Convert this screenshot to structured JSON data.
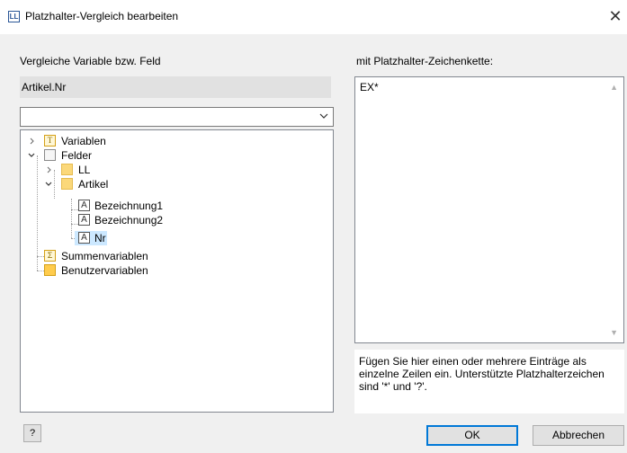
{
  "window": {
    "app_icon_text": "LL",
    "title": "Platzhalter-Vergleich bearbeiten",
    "close_glyph": "✕"
  },
  "left": {
    "label": "Vergleiche Variable bzw. Feld",
    "selected_value": "Artikel.Nr",
    "combo_value": "",
    "tree": {
      "variablen": "Variablen",
      "felder": "Felder",
      "ll": "LL",
      "artikel": "Artikel",
      "bezeichnung1": "Bezeichnung1",
      "bezeichnung2": "Bezeichnung2",
      "nr": "Nr",
      "summenvariablen": "Summenvariablen",
      "benutzervariablen": "Benutzervariablen"
    }
  },
  "right": {
    "label": "mit Platzhalter-Zeichenkette:",
    "pattern_value": "EX*",
    "hint": "Fügen Sie hier einen oder mehrere Einträge als einzelne Zeilen ein. Unterstützte Platzhalterzeichen sind '*' und '?'."
  },
  "buttons": {
    "help": "?",
    "ok": "OK",
    "cancel": "Abbrechen"
  },
  "icons": {
    "variables": "variable-icon",
    "fields": "fields-table-icon",
    "folder": "folder-icon",
    "text_field": "text-field-icon",
    "sum": "sum-icon",
    "user": "user-variable-icon"
  },
  "colors": {
    "selection": "#cce8ff",
    "ok_border": "#0078d7",
    "dialog_bg": "#f0f0f0"
  }
}
